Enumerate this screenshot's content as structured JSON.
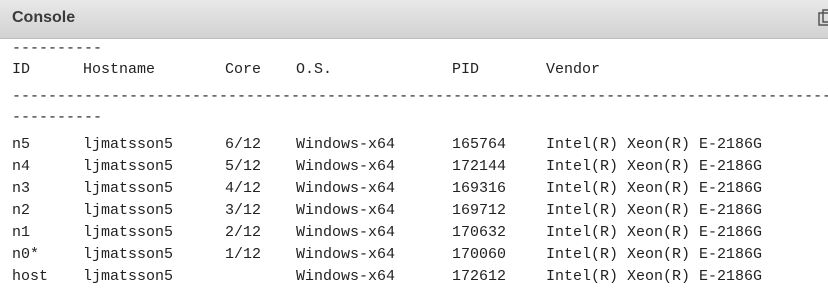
{
  "panel": {
    "title": "Console"
  },
  "output": {
    "separator_short": "----------",
    "separator_long": "----------------------------------------------------------------------------------------------------",
    "columns": [
      "ID",
      "Hostname",
      "Core",
      "O.S.",
      "PID",
      "Vendor"
    ],
    "rows": [
      {
        "id": "n5",
        "hostname": "ljmatsson5",
        "core": "6/12",
        "os": "Windows-x64",
        "pid": "165764",
        "vendor": "Intel(R) Xeon(R) E-2186G"
      },
      {
        "id": "n4",
        "hostname": "ljmatsson5",
        "core": "5/12",
        "os": "Windows-x64",
        "pid": "172144",
        "vendor": "Intel(R) Xeon(R) E-2186G"
      },
      {
        "id": "n3",
        "hostname": "ljmatsson5",
        "core": "4/12",
        "os": "Windows-x64",
        "pid": "169316",
        "vendor": "Intel(R) Xeon(R) E-2186G"
      },
      {
        "id": "n2",
        "hostname": "ljmatsson5",
        "core": "3/12",
        "os": "Windows-x64",
        "pid": "169712",
        "vendor": "Intel(R) Xeon(R) E-2186G"
      },
      {
        "id": "n1",
        "hostname": "ljmatsson5",
        "core": "2/12",
        "os": "Windows-x64",
        "pid": "170632",
        "vendor": "Intel(R) Xeon(R) E-2186G"
      },
      {
        "id": "n0*",
        "hostname": "ljmatsson5",
        "core": "1/12",
        "os": "Windows-x64",
        "pid": "170060",
        "vendor": "Intel(R) Xeon(R) E-2186G"
      },
      {
        "id": "host",
        "hostname": "ljmatsson5",
        "core": "",
        "os": "Windows-x64",
        "pid": "172612",
        "vendor": "Intel(R) Xeon(R) E-2186G"
      }
    ]
  },
  "icons": {
    "header_action": "copy-icon"
  },
  "colors": {
    "header_bg": "#d8d8d8",
    "text": "#222222"
  }
}
